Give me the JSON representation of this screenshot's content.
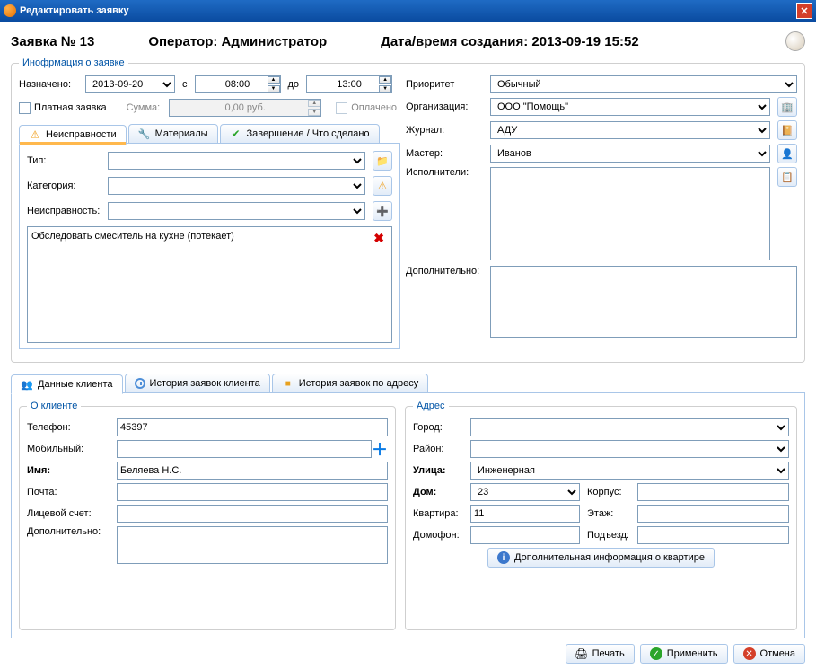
{
  "window": {
    "title": "Редактировать заявку"
  },
  "header": {
    "request_no_label": "Заявка № 13",
    "operator_label": "Оператор: Администратор",
    "created_label": "Дата/время создания: 2013-09-19 15:52"
  },
  "info": {
    "legend": "Инофрмация о заявке",
    "assigned_label": "Назначено:",
    "assigned_date": "2013-09-20",
    "from_label": "с",
    "time_from": "08:00",
    "to_label": "до",
    "time_to": "13:00",
    "paid_label": "Платная заявка",
    "sum_label": "Сумма:",
    "sum_value": "0,00 руб.",
    "paid_flag_label": "Оплачено"
  },
  "tabs_faults": {
    "faults": "Неисправности",
    "materials": "Материалы",
    "completion": "Завершение / Что сделано"
  },
  "faults": {
    "type_label": "Тип:",
    "category_label": "Категория:",
    "fault_label": "Неисправность:",
    "item": "Обследовать смеситель на кухне (потекает)"
  },
  "right": {
    "priority_label": "Приоритет",
    "priority_value": "Обычный",
    "org_label": "Организация:",
    "org_value": "ООО \"Помощь\"",
    "journal_label": "Журнал:",
    "journal_value": "АДУ",
    "master_label": "Мастер:",
    "master_value": "Иванов",
    "executors_label": "Исполнители:",
    "additional_label": "Дополнительно:"
  },
  "client_tabs": {
    "data": "Данные клиента",
    "history": "История заявок клиента",
    "addr_history": "История заявок по адресу"
  },
  "client": {
    "legend": "О клиенте",
    "phone_label": "Телефон:",
    "phone": "45397",
    "mobile_label": "Мобильный:",
    "mobile": "",
    "name_label": "Имя:",
    "name": "Беляева Н.С.",
    "email_label": "Почта:",
    "email": "",
    "account_label": "Лицевой счет:",
    "account": "",
    "additional_label": "Дополнительно:",
    "additional": ""
  },
  "address": {
    "legend": "Адрес",
    "city_label": "Город:",
    "city": "",
    "district_label": "Район:",
    "district": "",
    "street_label": "Улица:",
    "street": "Инженерная",
    "house_label": "Дом:",
    "house": "23",
    "building_label": "Корпус:",
    "building": "",
    "flat_label": "Квартира:",
    "flat": "11",
    "floor_label": "Этаж:",
    "floor": "",
    "intercom_label": "Домофон:",
    "intercom": "",
    "entrance_label": "Подъезд:",
    "entrance": "",
    "more_info_btn": "Дополнительная информация о квартире"
  },
  "footer": {
    "print": "Печать",
    "apply": "Применить",
    "cancel": "Отмена"
  }
}
